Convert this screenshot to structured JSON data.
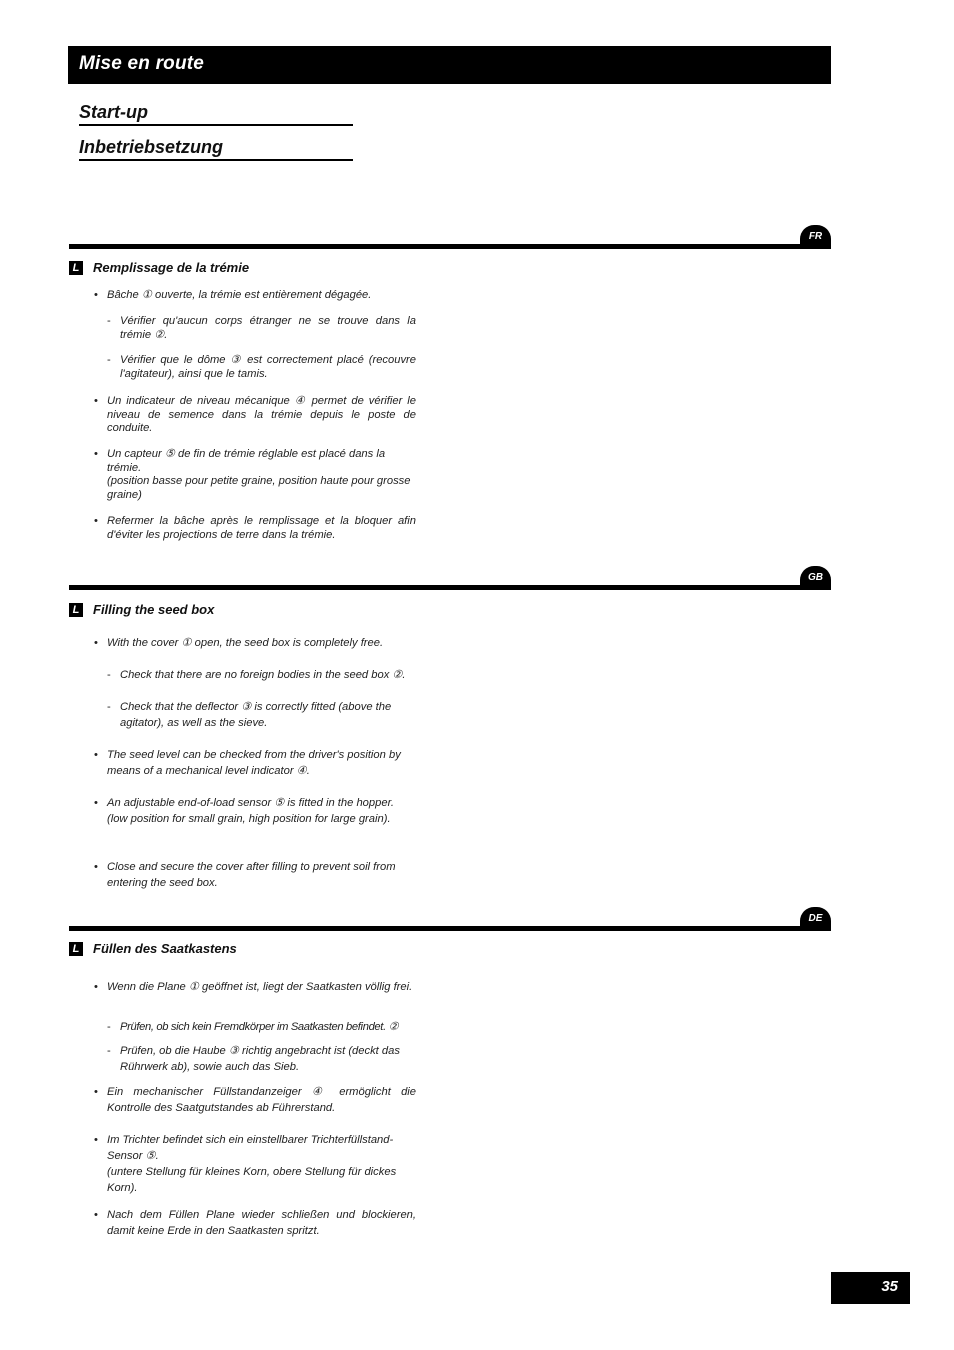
{
  "header": {
    "title": "Mise en route",
    "subtitles": [
      "Start-up",
      "Inbetriebsetzung"
    ]
  },
  "sections": [
    {
      "lang": "FR",
      "icon": "L",
      "title": "Remplissage de la trémie",
      "items": [
        {
          "type": "bullet",
          "text": "Bâche ① ouverte, la trémie est entièrement dégagée."
        },
        {
          "type": "dash",
          "text": "Vérifier qu'aucun corps étranger ne se trouve dans la trémie ②."
        },
        {
          "type": "dash",
          "text": "Vérifier que le dôme ③ est correctement placé (recouvre l'agitateur), ainsi que le tamis."
        },
        {
          "type": "bullet",
          "text": "Un indicateur de niveau mécanique ④ permet de vérifier le niveau de semence dans la trémie depuis le poste de conduite."
        },
        {
          "type": "bullet",
          "text": "Un capteur ⑤ de fin de trémie réglable est placé dans la trémie.",
          "text2": "(position basse pour petite graine, position haute pour grosse graine)"
        },
        {
          "type": "bullet",
          "text": "Refermer la bâche après le remplissage et la bloquer afin d'éviter les projections de terre dans la trémie."
        }
      ]
    },
    {
      "lang": "GB",
      "icon": "L",
      "title": "Filling the seed box",
      "items": [
        {
          "type": "bullet",
          "text": "With the cover ① open, the seed box is completely free."
        },
        {
          "type": "dash",
          "text": "Check that there are no foreign bodies in the seed box ②."
        },
        {
          "type": "dash",
          "text": "Check that the deflector ③ is correctly fitted (above the agitator), as well as the sieve."
        },
        {
          "type": "bullet",
          "text": "The seed level can be checked from the driver's position by means of a mechanical level indicator ④."
        },
        {
          "type": "bullet",
          "text": "An adjustable end-of-load sensor ⑤ is fitted in the hopper. (low position for small grain, high position for large grain)."
        },
        {
          "type": "bullet",
          "text": "Close and secure the cover after filling to prevent soil from entering the seed box."
        }
      ]
    },
    {
      "lang": "DE",
      "icon": "L",
      "title": "Füllen des Saatkastens",
      "items": [
        {
          "type": "bullet",
          "text": "Wenn die Plane ① geöffnet ist, liegt der Saatkasten völlig frei."
        },
        {
          "type": "dash",
          "text": "Prüfen, ob sich kein Fremdkörper im Saatkasten befindet. ②"
        },
        {
          "type": "dash",
          "text": "Prüfen, ob die Haube ③ richtig angebracht ist (deckt das Rührwerk ab), sowie auch das Sieb."
        },
        {
          "type": "bullet",
          "text": "Ein mechanischer Füllstandanzeiger ④ ermöglicht die Kontrolle des Saatgutstandes ab Führerstand."
        },
        {
          "type": "bullet",
          "text": "Im Trichter befindet sich ein einstellbarer Trichterfüllstand-Sensor ⑤.",
          "text2": "(untere Stellung für kleines Korn, obere Stellung für dickes Korn)."
        },
        {
          "type": "bullet",
          "text": "Nach dem Füllen Plane wieder schließen und blockieren, damit keine Erde in den Saatkasten spritzt."
        }
      ]
    }
  ],
  "markers": {
    "bullet": "•",
    "dash": "-"
  },
  "footer": {
    "page_number": "35"
  }
}
